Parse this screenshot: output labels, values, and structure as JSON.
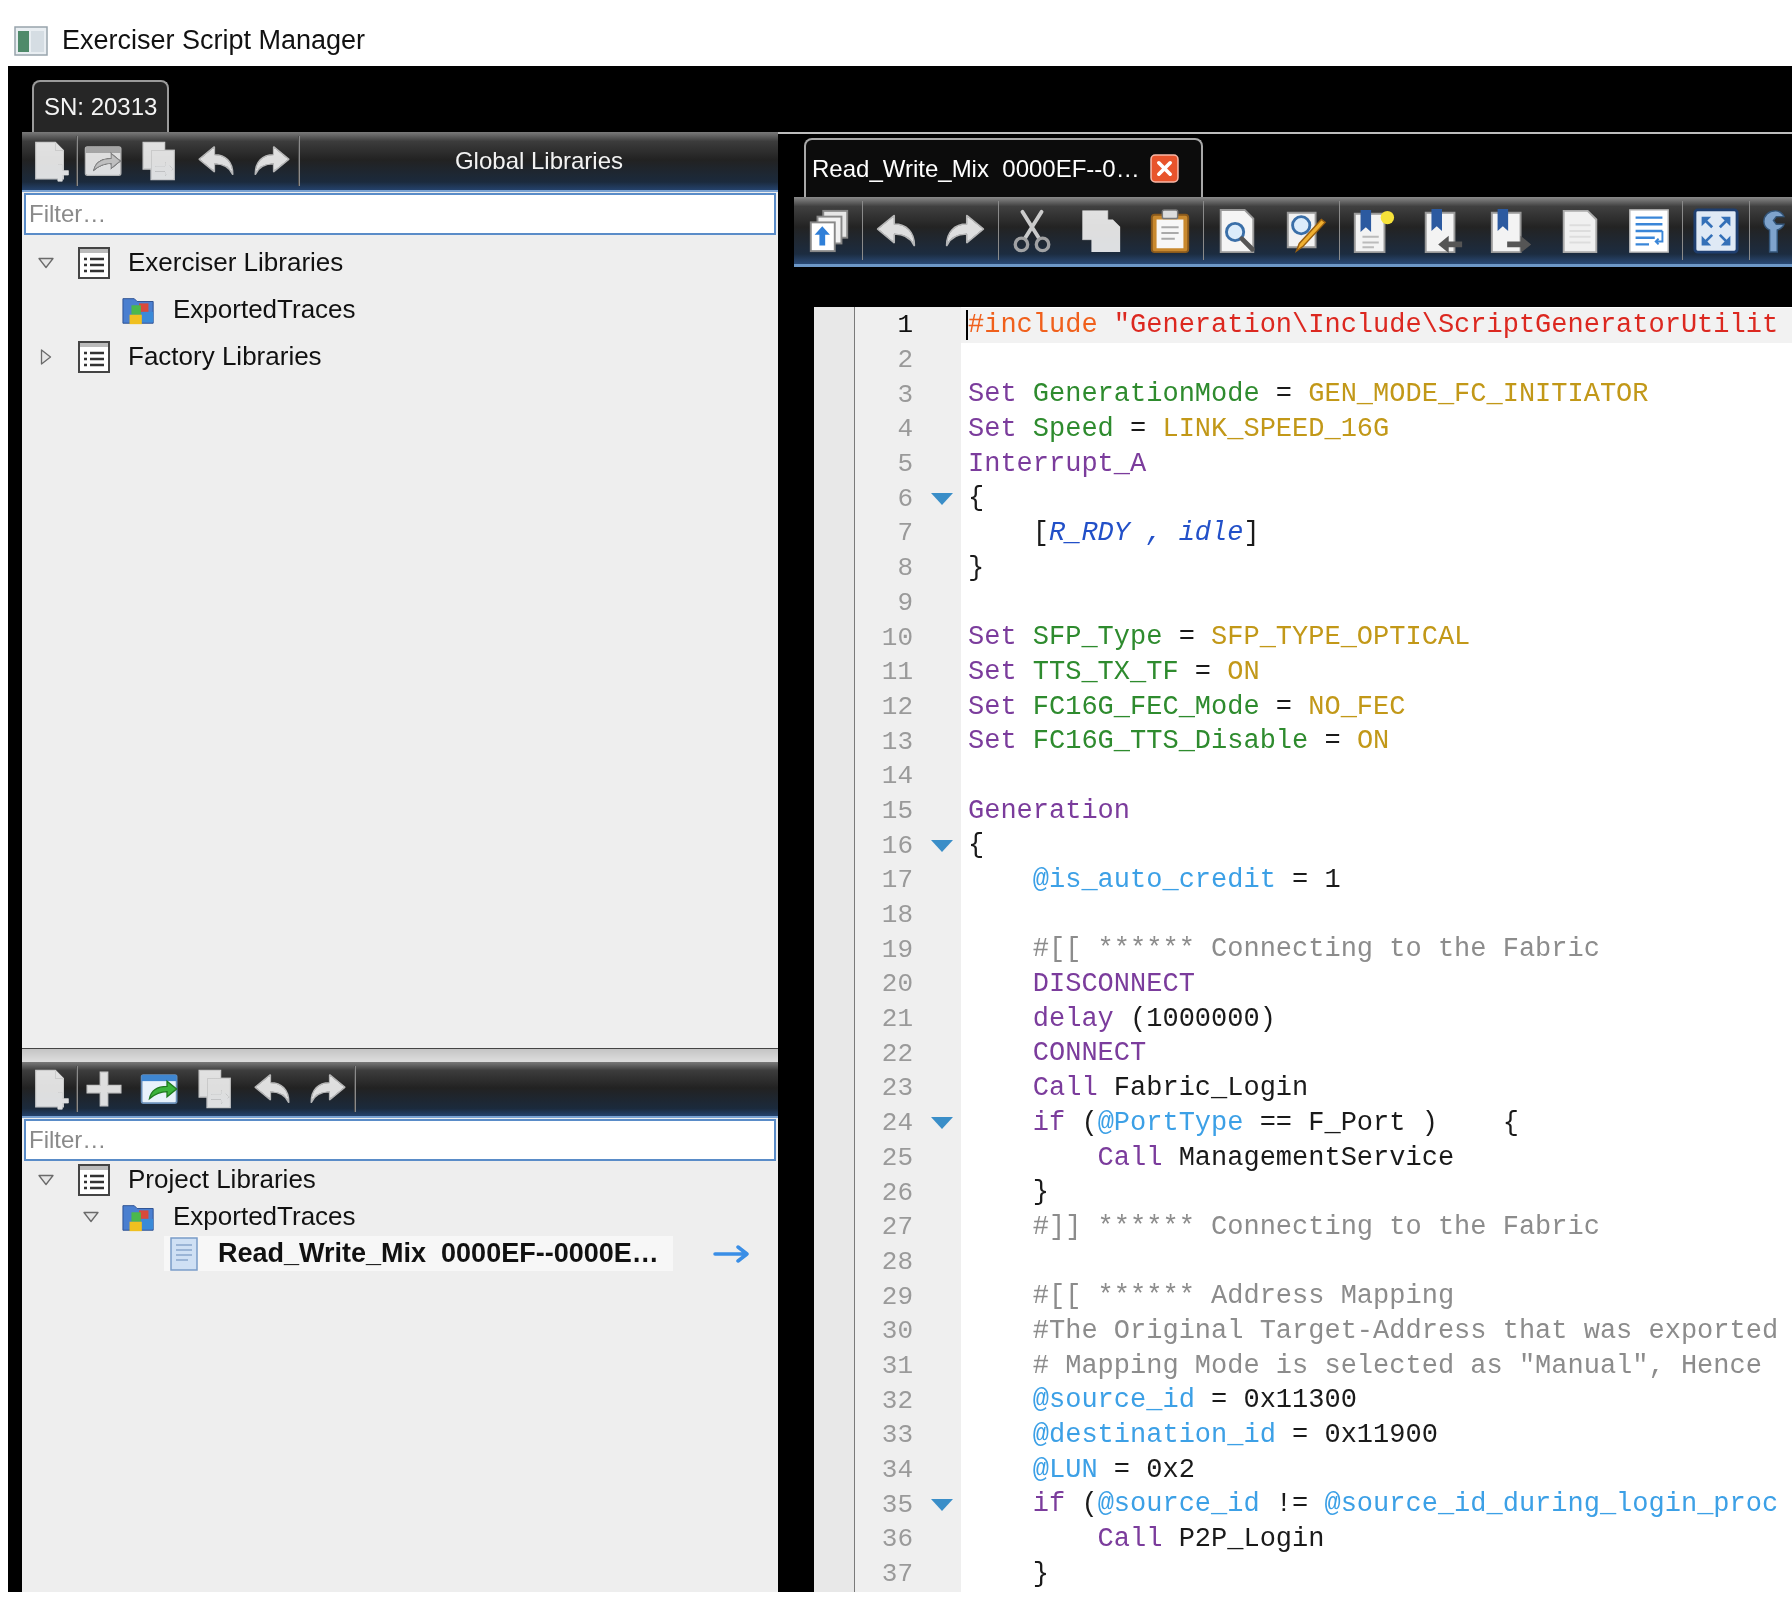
{
  "window": {
    "title": "Exerciser Script Manager"
  },
  "device_tab": {
    "label": "SN: 20313",
    "selected": true
  },
  "libraries_panels": [
    {
      "title": "Global Libraries",
      "toolbar": {
        "groups": [
          [
            {
              "disabled": true
            }
          ],
          [
            {
              "disabled": true
            },
            {
              "disabled": true
            },
            {
              "disabled": true
            },
            {
              "disabled": true
            }
          ]
        ]
      },
      "filter": {
        "placeholder": "Filter…"
      },
      "tree": [
        {
          "label": "Exerciser Libraries",
          "expanded": true,
          "selected": false,
          "children": [
            {
              "label": "ExportedTraces",
              "selected": false
            }
          ]
        },
        {
          "label": "Factory Libraries",
          "expanded": false,
          "selected": false
        }
      ]
    },
    {
      "toolbar": {
        "groups": [
          [
            {
              "disabled": true
            }
          ],
          [
            {
              "disabled": true
            },
            {
              "disabled": false
            },
            {
              "disabled": true
            },
            {
              "disabled": true
            },
            {
              "disabled": true
            }
          ]
        ]
      },
      "filter": {
        "placeholder": "Filter…"
      },
      "tree": [
        {
          "label": "Project Libraries",
          "expanded": true,
          "selected": false,
          "children": [
            {
              "label": "ExportedTraces",
              "expanded": true,
              "selected": false,
              "children": [
                {
                  "label": "Read_Write_Mix  0000EF--0000E…",
                  "selected": true
                }
              ]
            }
          ]
        }
      ]
    }
  ],
  "editor": {
    "tab": {
      "label": "Read_Write_Mix  0000EF--0…",
      "selected": true
    },
    "toolbar": {
      "groups": [
        [
          {
            "disabled": false
          }
        ],
        [
          {
            "disabled": true
          },
          {
            "disabled": true
          }
        ],
        [
          {
            "disabled": true
          },
          {
            "disabled": true
          },
          {
            "disabled": false
          }
        ],
        [
          {
            "disabled": false
          },
          {
            "disabled": false
          }
        ],
        [
          {
            "disabled": false
          },
          {
            "disabled": false
          },
          {
            "disabled": false
          },
          {
            "disabled": false
          },
          {
            "disabled": false
          }
        ],
        [
          {
            "disabled": false
          }
        ],
        [
          {
            "disabled": false
          }
        ]
      ]
    },
    "lines": [
      {
        "number": "1",
        "current": true,
        "fold": false,
        "tokens": [
          {
            "kind": "directive",
            "text": "#include"
          },
          {
            "kind": "string",
            "text": " \"Generation\\Include\\ScriptGeneratorUtilit"
          }
        ]
      },
      {
        "number": "2",
        "current": false,
        "fold": false
      },
      {
        "number": "3",
        "current": false,
        "fold": false,
        "tokens": [
          {
            "kind": "keyword",
            "text": "Set"
          },
          {
            "kind": "variable",
            "text": " GenerationMode"
          },
          {
            "kind": "plain",
            "text": " = "
          },
          {
            "kind": "constant",
            "text": "GEN_MODE_FC_INITIATOR"
          }
        ]
      },
      {
        "number": "4",
        "current": false,
        "fold": false,
        "tokens": [
          {
            "kind": "keyword",
            "text": "Set"
          },
          {
            "kind": "variable",
            "text": " Speed"
          },
          {
            "kind": "plain",
            "text": " = "
          },
          {
            "kind": "constant",
            "text": "LINK_SPEED_16G"
          }
        ]
      },
      {
        "number": "5",
        "current": false,
        "fold": false,
        "tokens": [
          {
            "kind": "keyword",
            "text": "Interrupt_A"
          }
        ]
      },
      {
        "number": "6",
        "current": false,
        "fold": true,
        "tokens": [
          {
            "kind": "plain",
            "text": "{"
          }
        ]
      },
      {
        "number": "7",
        "current": false,
        "fold": false,
        "tokens": [
          {
            "kind": "plain",
            "text": "    ["
          },
          {
            "kind": "param",
            "text": "R_RDY , idle"
          },
          {
            "kind": "plain",
            "text": "]"
          }
        ]
      },
      {
        "number": "8",
        "current": false,
        "fold": false,
        "tokens": [
          {
            "kind": "plain",
            "text": "}"
          }
        ]
      },
      {
        "number": "9",
        "current": false,
        "fold": false
      },
      {
        "number": "10",
        "current": false,
        "fold": false,
        "tokens": [
          {
            "kind": "keyword",
            "text": "Set"
          },
          {
            "kind": "variable",
            "text": " SFP_Type"
          },
          {
            "kind": "plain",
            "text": " = "
          },
          {
            "kind": "constant",
            "text": "SFP_TYPE_OPTICAL"
          }
        ]
      },
      {
        "number": "11",
        "current": false,
        "fold": false,
        "tokens": [
          {
            "kind": "keyword",
            "text": "Set"
          },
          {
            "kind": "variable",
            "text": " TTS_TX_TF"
          },
          {
            "kind": "plain",
            "text": " = "
          },
          {
            "kind": "constant",
            "text": "ON"
          }
        ]
      },
      {
        "number": "12",
        "current": false,
        "fold": false,
        "tokens": [
          {
            "kind": "keyword",
            "text": "Set"
          },
          {
            "kind": "variable",
            "text": " FC16G_FEC_Mode"
          },
          {
            "kind": "plain",
            "text": " = "
          },
          {
            "kind": "constant",
            "text": "NO_FEC"
          }
        ]
      },
      {
        "number": "13",
        "current": false,
        "fold": false,
        "tokens": [
          {
            "kind": "keyword",
            "text": "Set"
          },
          {
            "kind": "variable",
            "text": " FC16G_TTS_Disable"
          },
          {
            "kind": "plain",
            "text": " = "
          },
          {
            "kind": "constant",
            "text": "ON"
          }
        ]
      },
      {
        "number": "14",
        "current": false,
        "fold": false
      },
      {
        "number": "15",
        "current": false,
        "fold": false,
        "tokens": [
          {
            "kind": "keyword",
            "text": "Generation"
          }
        ]
      },
      {
        "number": "16",
        "current": false,
        "fold": true,
        "tokens": [
          {
            "kind": "plain",
            "text": "{"
          }
        ]
      },
      {
        "number": "17",
        "current": false,
        "fold": false,
        "tokens": [
          {
            "kind": "attribute",
            "text": "    @is_auto_credit"
          },
          {
            "kind": "plain",
            "text": " = 1"
          }
        ]
      },
      {
        "number": "18",
        "current": false,
        "fold": false
      },
      {
        "number": "19",
        "current": false,
        "fold": false,
        "tokens": [
          {
            "kind": "comment",
            "text": "    #[[ ****** Connecting to the Fabric"
          }
        ]
      },
      {
        "number": "20",
        "current": false,
        "fold": false,
        "tokens": [
          {
            "kind": "keyword",
            "text": "    DISCONNECT"
          }
        ]
      },
      {
        "number": "21",
        "current": false,
        "fold": false,
        "tokens": [
          {
            "kind": "keyword",
            "text": "    delay"
          },
          {
            "kind": "plain",
            "text": " (1000000)"
          }
        ]
      },
      {
        "number": "22",
        "current": false,
        "fold": false,
        "tokens": [
          {
            "kind": "keyword",
            "text": "    CONNECT"
          }
        ]
      },
      {
        "number": "23",
        "current": false,
        "fold": false,
        "tokens": [
          {
            "kind": "keyword",
            "text": "    Call"
          },
          {
            "kind": "plain",
            "text": " Fabric_Login"
          }
        ]
      },
      {
        "number": "24",
        "current": false,
        "fold": true,
        "tokens": [
          {
            "kind": "keyword",
            "text": "    if"
          },
          {
            "kind": "plain",
            "text": " ("
          },
          {
            "kind": "attribute",
            "text": "@PortType"
          },
          {
            "kind": "plain",
            "text": " == F_Port )    {"
          }
        ]
      },
      {
        "number": "25",
        "current": false,
        "fold": false,
        "tokens": [
          {
            "kind": "keyword",
            "text": "        Call"
          },
          {
            "kind": "plain",
            "text": " ManagementService"
          }
        ]
      },
      {
        "number": "26",
        "current": false,
        "fold": false,
        "tokens": [
          {
            "kind": "plain",
            "text": "    }"
          }
        ]
      },
      {
        "number": "27",
        "current": false,
        "fold": false,
        "tokens": [
          {
            "kind": "comment",
            "text": "    #]] ****** Connecting to the Fabric"
          }
        ]
      },
      {
        "number": "28",
        "current": false,
        "fold": false
      },
      {
        "number": "29",
        "current": false,
        "fold": false,
        "tokens": [
          {
            "kind": "comment",
            "text": "    #[[ ****** Address Mapping"
          }
        ]
      },
      {
        "number": "30",
        "current": false,
        "fold": false,
        "tokens": [
          {
            "kind": "comment",
            "text": "    #The Original Target-Address that was exported"
          }
        ]
      },
      {
        "number": "31",
        "current": false,
        "fold": false,
        "tokens": [
          {
            "kind": "comment",
            "text": "    # Mapping Mode is selected as \"Manual\", Hence"
          }
        ]
      },
      {
        "number": "32",
        "current": false,
        "fold": false,
        "tokens": [
          {
            "kind": "attribute",
            "text": "    @source_id"
          },
          {
            "kind": "plain",
            "text": " = 0x11300"
          }
        ]
      },
      {
        "number": "33",
        "current": false,
        "fold": false,
        "tokens": [
          {
            "kind": "attribute",
            "text": "    @destination_id"
          },
          {
            "kind": "plain",
            "text": " = 0x11900"
          }
        ]
      },
      {
        "number": "34",
        "current": false,
        "fold": false,
        "tokens": [
          {
            "kind": "attribute",
            "text": "    @LUN"
          },
          {
            "kind": "plain",
            "text": " = 0x2"
          }
        ]
      },
      {
        "number": "35",
        "current": false,
        "fold": true,
        "tokens": [
          {
            "kind": "keyword",
            "text": "    if"
          },
          {
            "kind": "plain",
            "text": " ("
          },
          {
            "kind": "attribute",
            "text": "@source_id"
          },
          {
            "kind": "plain",
            "text": " != "
          },
          {
            "kind": "attribute",
            "text": "@source_id_during_login_proc"
          }
        ]
      },
      {
        "number": "36",
        "current": false,
        "fold": false,
        "tokens": [
          {
            "kind": "keyword",
            "text": "        Call"
          },
          {
            "kind": "plain",
            "text": " P2P_Login"
          }
        ]
      },
      {
        "number": "37",
        "current": false,
        "fold": false,
        "tokens": [
          {
            "kind": "plain",
            "text": "    }"
          }
        ]
      }
    ]
  }
}
